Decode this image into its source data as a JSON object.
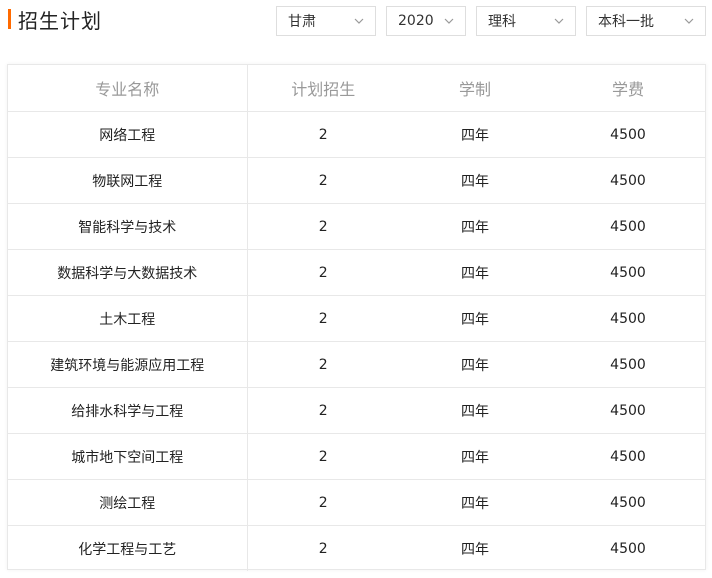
{
  "header": {
    "title": "招生计划",
    "accent_color": "#ff6a00"
  },
  "filters": {
    "province": "甘肃",
    "year": "2020",
    "subject": "理科",
    "batch": "本科一批",
    "chevron_icon": "chevron-down-icon"
  },
  "table": {
    "headers": [
      "专业名称",
      "计划招生",
      "学制",
      "学费"
    ],
    "rows": [
      [
        "网络工程",
        "2",
        "四年",
        "4500"
      ],
      [
        "物联网工程",
        "2",
        "四年",
        "4500"
      ],
      [
        "智能科学与技术",
        "2",
        "四年",
        "4500"
      ],
      [
        "数据科学与大数据技术",
        "2",
        "四年",
        "4500"
      ],
      [
        "土木工程",
        "2",
        "四年",
        "4500"
      ],
      [
        "建筑环境与能源应用工程",
        "2",
        "四年",
        "4500"
      ],
      [
        "给排水科学与工程",
        "2",
        "四年",
        "4500"
      ],
      [
        "城市地下空间工程",
        "2",
        "四年",
        "4500"
      ],
      [
        "测绘工程",
        "2",
        "四年",
        "4500"
      ],
      [
        "化学工程与工艺",
        "2",
        "四年",
        "4500"
      ]
    ]
  }
}
